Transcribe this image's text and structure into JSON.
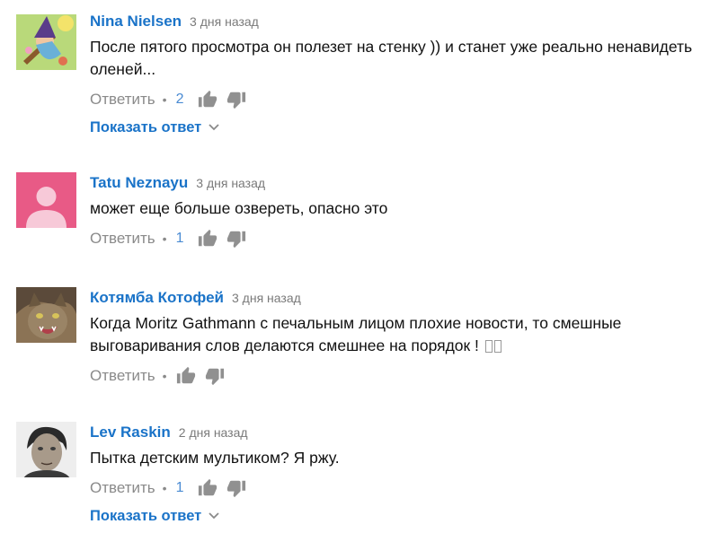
{
  "comments": [
    {
      "author": "Nina Nielsen",
      "time": "3 дня назад",
      "text": "После пятого просмотра он полезет на стенку )) и станет уже реально ненавидеть оленей...",
      "reply_label": "Ответить",
      "dot": "•",
      "likes": "2",
      "show_replies": "Показать ответ",
      "avatar_icon": "witch-cartoon-avatar"
    },
    {
      "author": "Tatu Neznayu",
      "time": "3 дня назад",
      "text": "может еще больше озвереть, опасно это",
      "reply_label": "Ответить",
      "dot": "•",
      "likes": "1",
      "avatar_icon": "default-user-avatar"
    },
    {
      "author": "Котямба Котофей",
      "time": "3 дня назад",
      "text": "Когда Moritz Gathmann с печальным лицом плохие новости, то смешные выговаривания слов делаются смешнее на порядок !",
      "reply_label": "Ответить",
      "dot": "•",
      "avatar_icon": "cat-photo-avatar"
    },
    {
      "author": "Lev Raskin",
      "time": "2 дня назад",
      "text": "Пытка детским мультиком? Я ржу.",
      "reply_label": "Ответить",
      "dot": "•",
      "likes": "1",
      "show_replies": "Показать ответ",
      "avatar_icon": "man-portrait-avatar"
    }
  ],
  "colors": {
    "link_blue": "#1a73c8",
    "muted": "#8a8a8a",
    "like_count": "#4a8bd3",
    "icon_gray": "#909090",
    "pink_avatar": "#e85a86"
  }
}
